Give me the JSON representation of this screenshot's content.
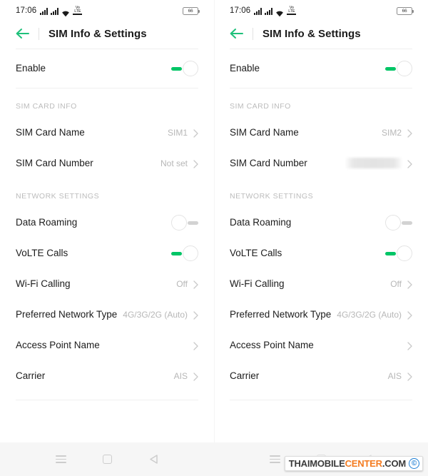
{
  "statusbar": {
    "time": "17:06",
    "battery_level": "66",
    "volte_label": "VoLTE"
  },
  "appbar": {
    "title": "SIM Info & Settings",
    "back_icon": "back-arrow-icon"
  },
  "panels": [
    {
      "id": "sim1",
      "enable": {
        "label": "Enable",
        "state": "on"
      },
      "sections": [
        {
          "heading": "SIM CARD INFO",
          "rows": [
            {
              "label": "SIM Card Name",
              "value": "SIM1",
              "type": "chevron"
            },
            {
              "label": "SIM Card Number",
              "value": "Not set",
              "type": "chevron"
            }
          ]
        },
        {
          "heading": "NETWORK SETTINGS",
          "rows": [
            {
              "label": "Data Roaming",
              "value": "",
              "type": "toggle",
              "state": "off"
            },
            {
              "label": "VoLTE Calls",
              "value": "",
              "type": "toggle",
              "state": "on"
            },
            {
              "label": "Wi-Fi Calling",
              "value": "Off",
              "type": "chevron"
            },
            {
              "label": "Preferred Network Type",
              "value": "4G/3G/2G (Auto)",
              "type": "chevron"
            },
            {
              "label": "Access Point Name",
              "value": "",
              "type": "chevron"
            },
            {
              "label": "Carrier",
              "value": "AIS",
              "type": "chevron"
            }
          ]
        }
      ]
    },
    {
      "id": "sim2",
      "enable": {
        "label": "Enable",
        "state": "on"
      },
      "sections": [
        {
          "heading": "SIM CARD INFO",
          "rows": [
            {
              "label": "SIM Card Name",
              "value": "SIM2",
              "type": "chevron"
            },
            {
              "label": "SIM Card Number",
              "value": "",
              "type": "redacted"
            }
          ]
        },
        {
          "heading": "NETWORK SETTINGS",
          "rows": [
            {
              "label": "Data Roaming",
              "value": "",
              "type": "toggle",
              "state": "off"
            },
            {
              "label": "VoLTE Calls",
              "value": "",
              "type": "toggle",
              "state": "on"
            },
            {
              "label": "Wi-Fi Calling",
              "value": "Off",
              "type": "chevron"
            },
            {
              "label": "Preferred Network Type",
              "value": "4G/3G/2G (Auto)",
              "type": "chevron"
            },
            {
              "label": "Access Point Name",
              "value": "",
              "type": "chevron"
            },
            {
              "label": "Carrier",
              "value": "AIS",
              "type": "chevron"
            }
          ]
        }
      ]
    }
  ],
  "navbar": {
    "items": [
      "menu-icon",
      "home-square-icon",
      "back-triangle-icon"
    ],
    "right_items": [
      "menu-icon"
    ]
  },
  "watermark": {
    "part1": "THAIMOBILE",
    "part2": "CENTER",
    "part3": ".COM",
    "badge": "©"
  },
  "colors": {
    "accent_green": "#00c566",
    "toggle_off": "#d2d2d2",
    "value_gray": "#b7b7b7",
    "watermark_orange": "#f47b20",
    "watermark_blue": "#1e7fd4"
  }
}
